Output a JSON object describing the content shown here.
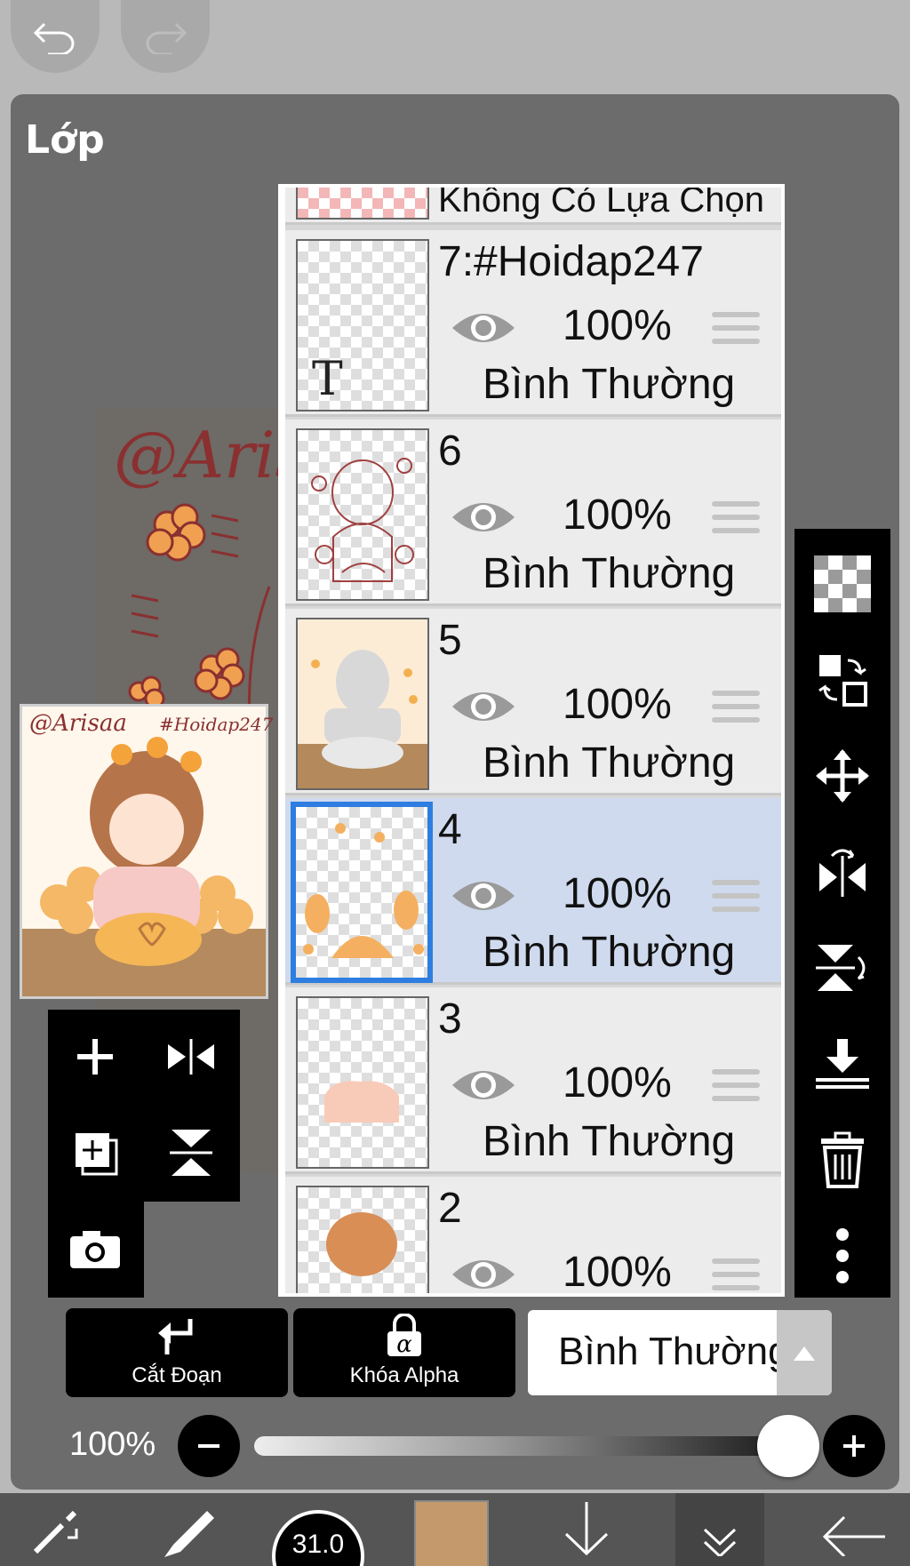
{
  "panel": {
    "title": "Lớp"
  },
  "layers": {
    "top_partial": {
      "name": "Không Có Lựa Chọn"
    },
    "items": [
      {
        "name": "7:#Hoidap247",
        "opacity": "100%",
        "blend": "Bình Thường",
        "selected": false
      },
      {
        "name": "6",
        "opacity": "100%",
        "blend": "Bình Thường",
        "selected": false
      },
      {
        "name": "5",
        "opacity": "100%",
        "blend": "Bình Thường",
        "selected": false
      },
      {
        "name": "4",
        "opacity": "100%",
        "blend": "Bình Thường",
        "selected": true
      },
      {
        "name": "3",
        "opacity": "100%",
        "blend": "Bình Thường",
        "selected": false
      },
      {
        "name": "2",
        "opacity": "100%",
        "blend": "Bình Thường",
        "selected": false
      }
    ]
  },
  "preview": {
    "watermark_left": "@Arisaa",
    "watermark_right": "#Hoidap247",
    "canvas_text": "@Aris"
  },
  "bottom": {
    "clip_label": "Cắt Đoạn",
    "alpha_lock_label": "Khóa Alpha",
    "alpha_symbol": "α",
    "blend_mode": "Bình Thường",
    "opacity_value": "100%",
    "brush_size": "31.0"
  },
  "colors": {
    "selected_row": "#cfdaee",
    "selection_border": "#2d7ee0",
    "current_color": "#c49a6c"
  },
  "icons": {
    "undo": "undo-icon",
    "redo": "redo-icon",
    "add_layer": "plus-icon",
    "duplicate": "duplicate-layer-icon",
    "camera": "camera-icon",
    "flip_h": "flip-horizontal-icon",
    "flip_v": "flip-vertical-icon",
    "checker": "transparency-icon",
    "swap": "swap-icon",
    "move": "move-icon",
    "merge_down": "merge-down-icon",
    "trash": "trash-icon",
    "more": "more-vertical-icon"
  }
}
